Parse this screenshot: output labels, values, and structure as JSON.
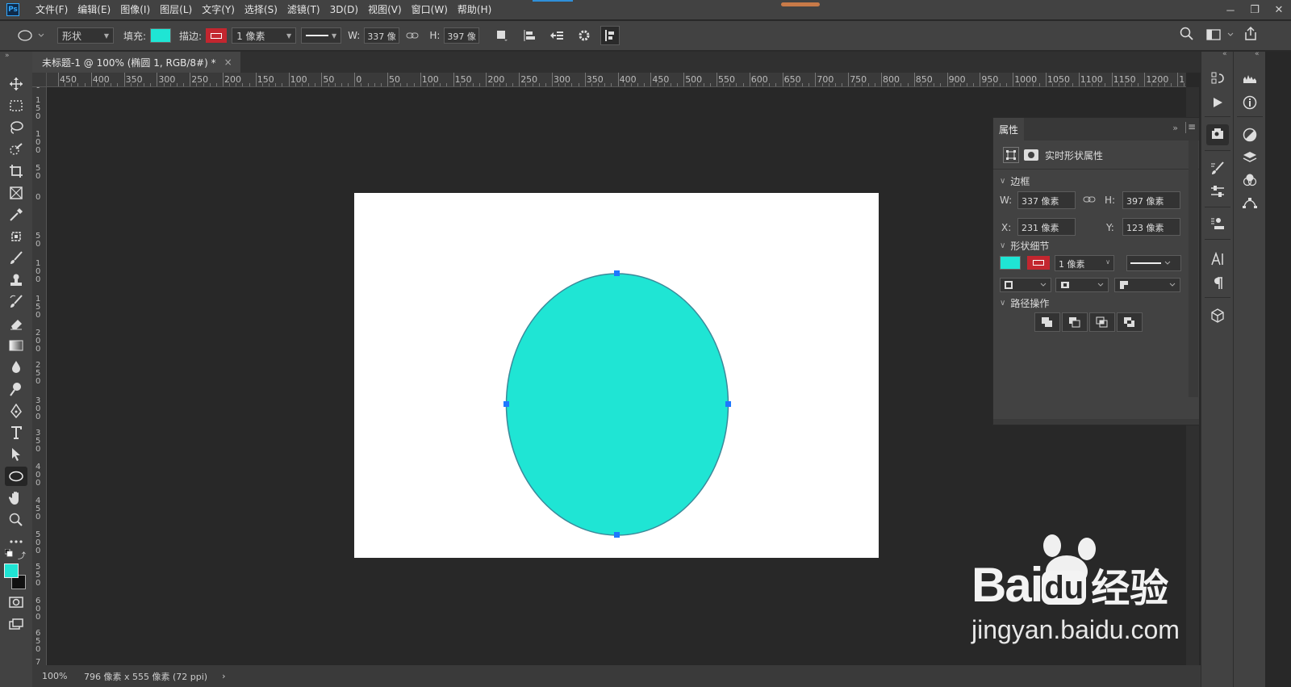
{
  "app": {
    "logo": "Ps",
    "accent": "#31a8ff"
  },
  "menu": [
    "文件(F)",
    "编辑(E)",
    "图像(I)",
    "图层(L)",
    "文字(Y)",
    "选择(S)",
    "滤镜(T)",
    "3D(D)",
    "视图(V)",
    "窗口(W)",
    "帮助(H)"
  ],
  "window_controls": {
    "minimize": "－",
    "restore": "❐",
    "close": "✕"
  },
  "options": {
    "mode": "形状",
    "fill_label": "填充:",
    "fill_color": "#1fe5d4",
    "stroke_label": "描边:",
    "stroke_color": "#c3262f",
    "stroke_width": "1 像素",
    "w_label": "W:",
    "w_value": "337 像",
    "h_label": "H:",
    "h_value": "397 像"
  },
  "document": {
    "tab_title": "未标题-1 @ 100% (椭圆 1, RGB/8#) *",
    "close": "×",
    "shape_color": "#1fe5d4",
    "shape_stroke": "#3b8a9a"
  },
  "ruler": {
    "h_labels": [
      "450",
      "400",
      "350",
      "300",
      "250",
      "200",
      "150",
      "100",
      "50",
      "0",
      "50",
      "100",
      "150",
      "200",
      "250",
      "300",
      "350",
      "400",
      "450",
      "500",
      "550",
      "600",
      "650",
      "700",
      "750",
      "800",
      "850",
      "900",
      "950",
      "1000",
      "1050",
      "1100",
      "1150",
      "1200",
      "1"
    ],
    "v_labels": [
      "0",
      "1\n5\n0",
      "1\n0\n0",
      "5\n0",
      "0",
      "5\n0",
      "1\n0\n0",
      "1\n5\n0",
      "2\n0\n0",
      "2\n5\n0",
      "3\n0\n0",
      "3\n5\n0",
      "4\n0\n0",
      "4\n5\n0",
      "5\n0\n0",
      "5\n5\n0",
      "6\n0\n0",
      "6\n5\n0",
      "7"
    ]
  },
  "status": {
    "zoom": "100%",
    "doc_size": "796 像素 x 555 像素 (72 ppi)",
    "arrow": "›"
  },
  "properties": {
    "tab": "属性",
    "live_shape": "实时形状属性",
    "section_bounds": "边框",
    "w_label": "W:",
    "w_value": "337 像素",
    "h_label": "H:",
    "h_value": "397 像素",
    "x_label": "X:",
    "x_value": "231 像素",
    "y_label": "Y:",
    "y_value": "123 像素",
    "section_shape": "形状细节",
    "stroke_width": "1 像素",
    "section_path": "路径操作"
  },
  "watermark": {
    "brand": "Bai",
    "brand2": "du",
    "cn": "经验",
    "url": "jingyan.baidu.com"
  }
}
